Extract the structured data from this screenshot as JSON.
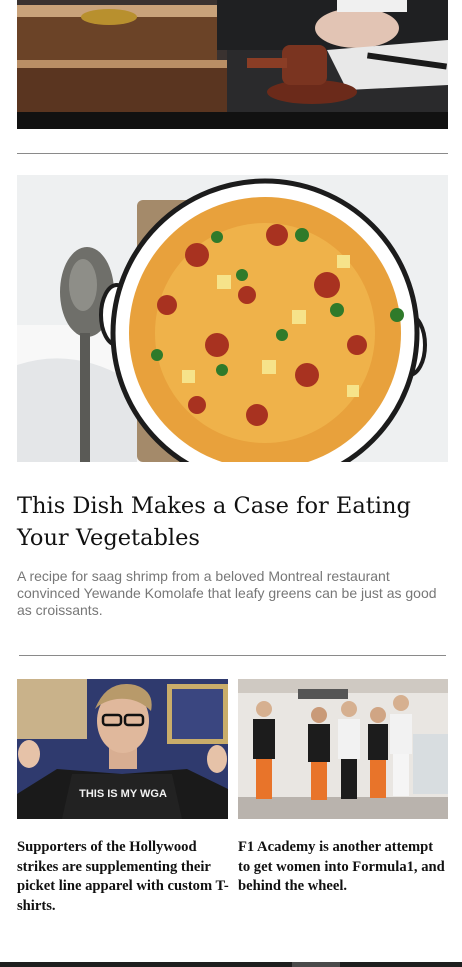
{
  "articles": [
    {
      "headline": "This Dish Makes a Case for Eating Your Vegetables",
      "dek": "A recipe for saag shrimp from a beloved Montreal restaurant convinced Yewande Komolafe that leafy greens can be just as good as croissants."
    }
  ],
  "cards": [
    {
      "title": "Supporters of the Hollywood strikes are supplementing their picket line apparel with custom T-shirts.",
      "shirt_text": "THIS IS MY WGA"
    },
    {
      "title": "F1 Academy is another attempt to get women into Formula1, and behind the wheel."
    }
  ]
}
